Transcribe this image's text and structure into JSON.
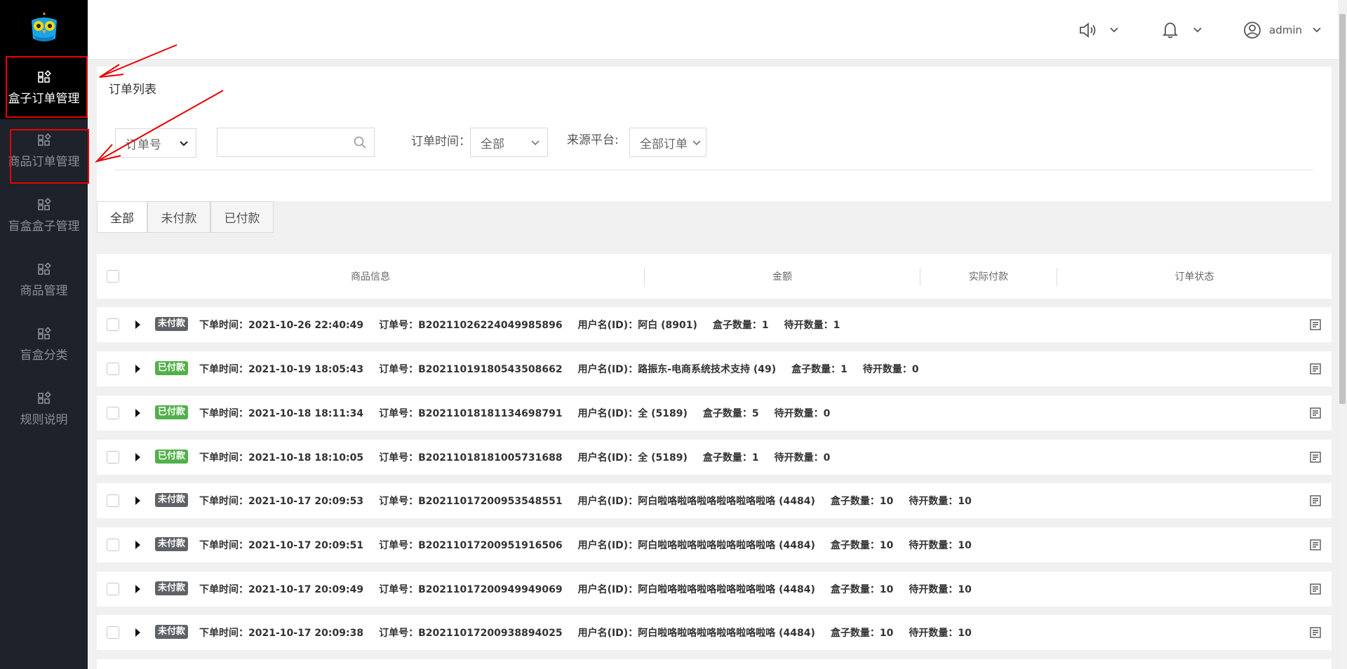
{
  "sidebar": {
    "items": [
      {
        "label": "盒子订单管理",
        "active": true
      },
      {
        "label": "商品订单管理",
        "active": false
      },
      {
        "label": "盲盒盒子管理",
        "active": false
      },
      {
        "label": "商品管理",
        "active": false
      },
      {
        "label": "盲盒分类",
        "active": false
      },
      {
        "label": "规则说明",
        "active": false
      }
    ]
  },
  "topbar": {
    "user": "admin",
    "icons": [
      "speaker-icon",
      "bell-icon",
      "user-icon"
    ]
  },
  "filters": {
    "title": "订单列表",
    "search_type": "订单号",
    "search_value": "",
    "time_label": "订单时间：",
    "time_value": "全部",
    "platform_label": "来源平台:",
    "platform_value": "全部订单"
  },
  "tabs": [
    "全部",
    "未付款",
    "已付款"
  ],
  "table": {
    "columns": [
      "商品信息",
      "金额",
      "实际付款",
      "订单状态"
    ],
    "rows": [
      {
        "status": "未付款",
        "time": "下单时间：2021-10-26 22:40:49",
        "order": "订单号：B20211026224049985896",
        "user": "用户名(ID)：阿白 (8901)",
        "boxes": "盒子数量：1",
        "pending": "待开数量：1"
      },
      {
        "status": "已付款",
        "time": "下单时间：2021-10-19 18:05:43",
        "order": "订单号：B20211019180543508662",
        "user": "用户名(ID)：路振东-电商系统技术支持 (49)",
        "boxes": "盒子数量：1",
        "pending": "待开数量：0"
      },
      {
        "status": "已付款",
        "time": "下单时间：2021-10-18 18:11:34",
        "order": "订单号：B20211018181134698791",
        "user": "用户名(ID)：全 (5189)",
        "boxes": "盒子数量：5",
        "pending": "待开数量：0"
      },
      {
        "status": "已付款",
        "time": "下单时间：2021-10-18 18:10:05",
        "order": "订单号：B20211018181005731688",
        "user": "用户名(ID)：全 (5189)",
        "boxes": "盒子数量：1",
        "pending": "待开数量：0"
      },
      {
        "status": "未付款",
        "time": "下单时间：2021-10-17 20:09:53",
        "order": "订单号：B20211017200953548551",
        "user": "用户名(ID)：阿白啦咯啦咯啦咯啦咯啦咯啦咯 (4484)",
        "boxes": "盒子数量：10",
        "pending": "待开数量：10"
      },
      {
        "status": "未付款",
        "time": "下单时间：2021-10-17 20:09:51",
        "order": "订单号：B20211017200951916506",
        "user": "用户名(ID)：阿白啦咯啦咯啦咯啦咯啦咯啦咯 (4484)",
        "boxes": "盒子数量：10",
        "pending": "待开数量：10"
      },
      {
        "status": "未付款",
        "time": "下单时间：2021-10-17 20:09:49",
        "order": "订单号：B20211017200949949069",
        "user": "用户名(ID)：阿白啦咯啦咯啦咯啦咯啦咯啦咯 (4484)",
        "boxes": "盒子数量：10",
        "pending": "待开数量：10"
      },
      {
        "status": "未付款",
        "time": "下单时间：2021-10-17 20:09:38",
        "order": "订单号：B20211017200938894025",
        "user": "用户名(ID)：阿白啦咯啦咯啦咯啦咯啦咯啦咯 (4484)",
        "boxes": "盒子数量：10",
        "pending": "待开数量：10"
      }
    ]
  },
  "colors": {
    "unpaid_badge": "#5f6368",
    "paid_badge": "#52b04a",
    "sidebar_bg": "#1e222b",
    "annotation_red": "#e60000"
  }
}
